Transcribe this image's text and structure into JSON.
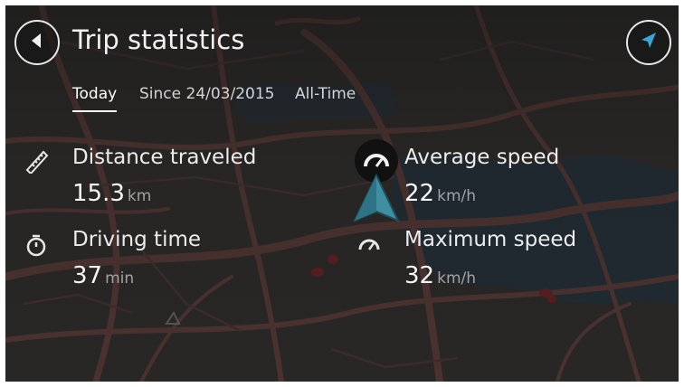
{
  "header": {
    "title": "Trip statistics",
    "back_icon": "back-arrow-icon",
    "nav_icon": "navigation-arrow-icon"
  },
  "tabs": [
    {
      "label": "Today",
      "active": true
    },
    {
      "label": "Since 24/03/2015",
      "active": false
    },
    {
      "label": "All-Time",
      "active": false
    }
  ],
  "stats": {
    "distance": {
      "label": "Distance traveled",
      "value": "15.3",
      "unit": "km",
      "icon": "ruler-icon"
    },
    "driving_time": {
      "label": "Driving time",
      "value": "37",
      "unit": "min",
      "icon": "stopwatch-icon"
    },
    "average_speed": {
      "label": "Average speed",
      "value": "22",
      "unit": "km/h",
      "icon": "speedometer-icon"
    },
    "maximum_speed": {
      "label": "Maximum speed",
      "value": "32",
      "unit": "km/h",
      "icon": "speedometer-icon"
    }
  },
  "colors": {
    "background": "#2b2a28",
    "road": "#5a3a36",
    "water": "#23303a",
    "text_primary": "#f2f2f2",
    "text_unit": "#a3a3a3",
    "vehicle": "#3f8ea2",
    "nav_accent": "#3aa6d8"
  }
}
